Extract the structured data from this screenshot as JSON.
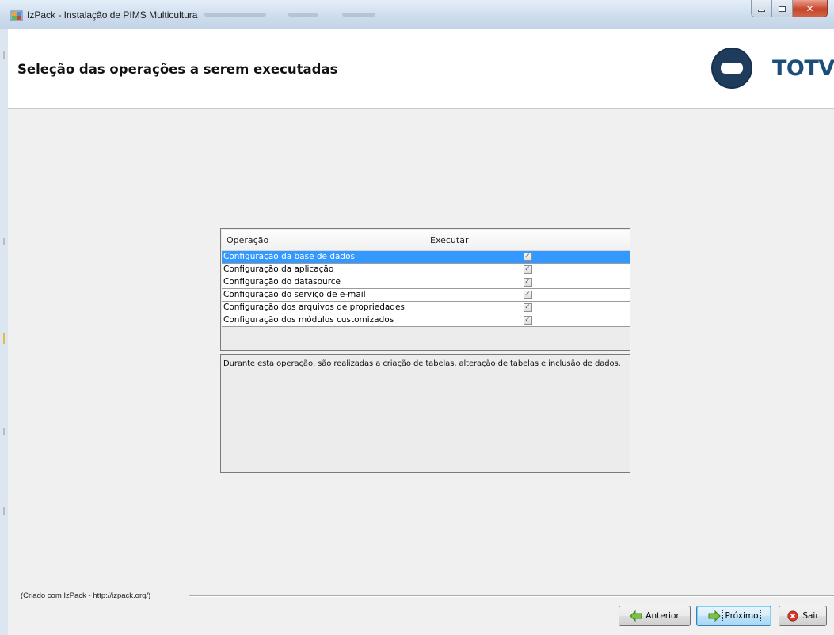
{
  "window": {
    "title": "IzPack - Instalação de PIMS Multicultura",
    "icon": "installer-app-icon",
    "controls": [
      "minimize-icon",
      "maximize-icon",
      "close-icon"
    ]
  },
  "header": {
    "title": "Seleção das operações a serem executadas",
    "logo_text": "TOTVS",
    "logo_color": "#1b4f7a"
  },
  "table": {
    "columns": [
      "Operação",
      "Executar"
    ],
    "rows": [
      {
        "operation": "Configuração da base de dados",
        "execute": true,
        "selected": true
      },
      {
        "operation": "Configuração da aplicação",
        "execute": true,
        "selected": false
      },
      {
        "operation": "Configuração do datasource",
        "execute": true,
        "selected": false
      },
      {
        "operation": "Configuração do serviço de e-mail",
        "execute": true,
        "selected": false
      },
      {
        "operation": "Configuração dos arquivos de propriedades",
        "execute": true,
        "selected": false
      },
      {
        "operation": "Configuração dos módulos customizados",
        "execute": true,
        "selected": false
      }
    ],
    "selection_color": "#3399ff"
  },
  "description": {
    "text": "Durante esta operação, são realizadas a criação de tabelas, alteração de tabelas e inclusão de dados."
  },
  "footer": {
    "credits": "(Criado com IzPack - http://izpack.org/)",
    "buttons": {
      "previous": {
        "label": "Anterior",
        "icon": "arrow-left-icon"
      },
      "next": {
        "label": "Próximo",
        "icon": "arrow-right-icon"
      },
      "exit": {
        "label": "Sair",
        "icon": "exit-icon"
      }
    }
  }
}
